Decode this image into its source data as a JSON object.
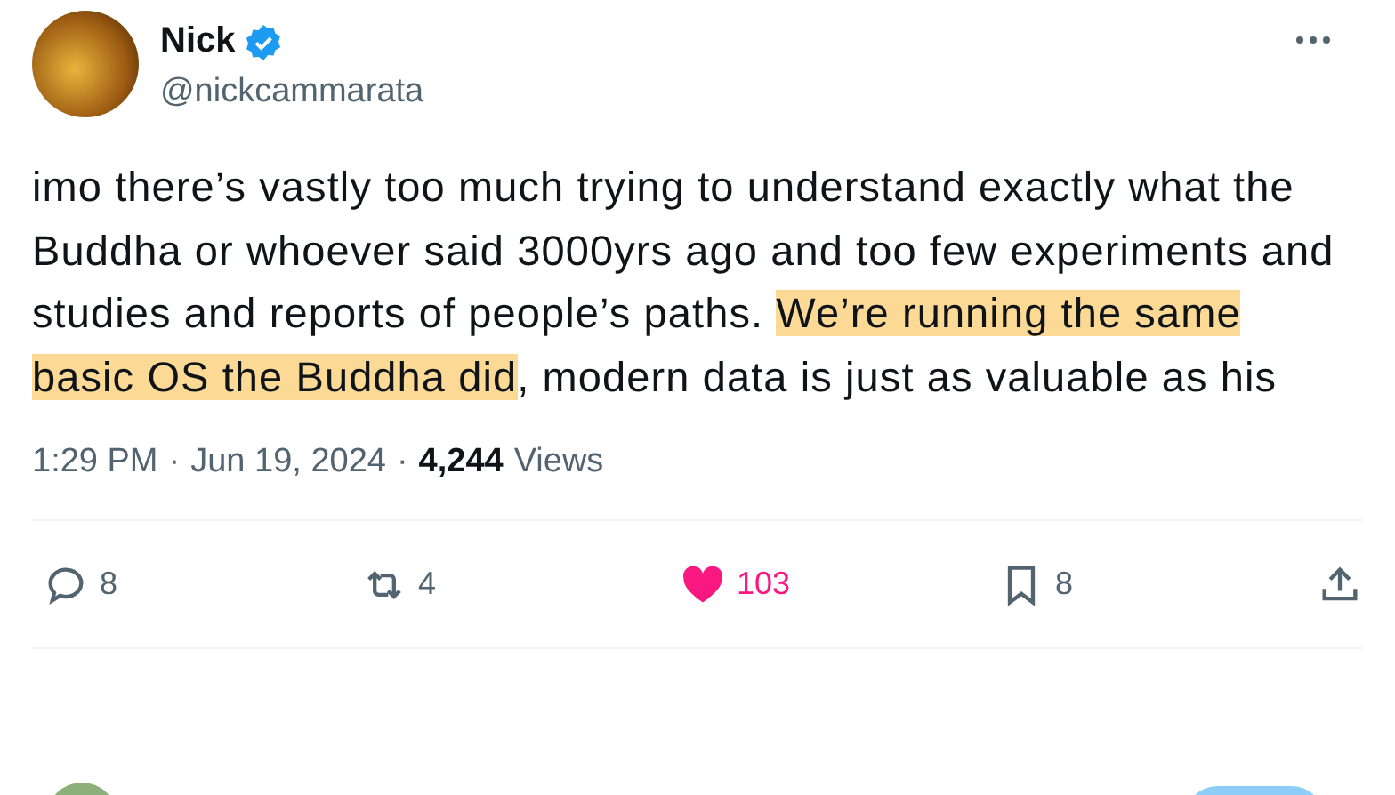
{
  "author": {
    "name": "Nick",
    "verified": true,
    "handle": "@nickcammarata"
  },
  "text": [
    {
      "text": "imo there’s vastly too much trying to understand exactly what the Buddha or whoever said 3000yrs ago and too few experiments and studies and reports of people’s paths. ",
      "highlighted": false
    },
    {
      "text": "We’re running the same basic OS the Buddha did",
      "highlighted": true
    },
    {
      "text": ", modern data is just as valuable as his",
      "highlighted": false
    }
  ],
  "meta": {
    "time": "1:29 PM",
    "separator_1": "·",
    "date": "Jun 19, 2024",
    "separator_2": "·",
    "views_count": "4,244",
    "views_label": "Views"
  },
  "actions": [
    {
      "kind": "reply",
      "count": "8",
      "active": false
    },
    {
      "kind": "repost",
      "count": "4",
      "active": false
    },
    {
      "kind": "like",
      "count": "103",
      "active": true
    },
    {
      "kind": "bookmark",
      "count": "8",
      "active": false
    },
    {
      "kind": "share",
      "active": false
    }
  ]
}
